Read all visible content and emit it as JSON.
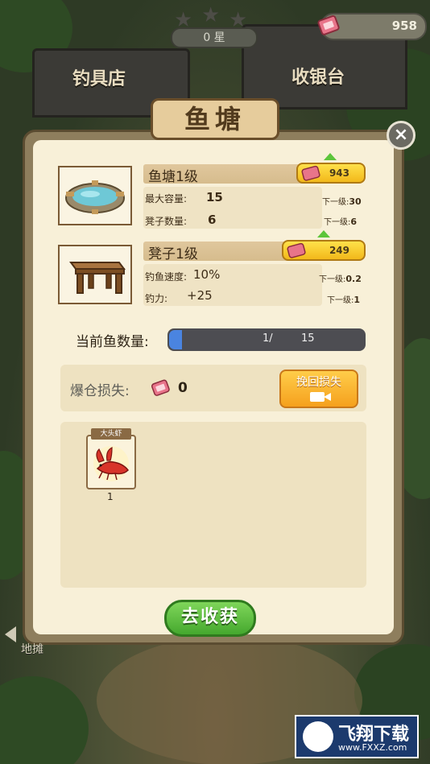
{
  "hud": {
    "star_count": "0 星",
    "currency": "958"
  },
  "scene": {
    "shop_left": "钓具店",
    "shop_right": "收银台",
    "side_label": "地摊"
  },
  "dialog": {
    "title": "鱼塘",
    "close": "×",
    "pond": {
      "level": "鱼塘1级",
      "upgrade_cost": "943",
      "stats": [
        {
          "label": "最大容量:",
          "value": "15",
          "next_label": "下一级:",
          "next_value": "30"
        },
        {
          "label": "凳子数量:",
          "value": "6",
          "next_label": "下一级:",
          "next_value": "6"
        }
      ]
    },
    "stool": {
      "level": "凳子1级",
      "upgrade_cost": "249",
      "stats": [
        {
          "label": "钓鱼速度:",
          "value": "10%",
          "next_label": "下一级:",
          "next_value": "0.2"
        },
        {
          "label": "钓力:",
          "value": "+25",
          "next_label": "下一级:",
          "next_value": "1"
        }
      ]
    },
    "fish_count": {
      "label": "当前鱼数量:",
      "current": "1/",
      "max": "15",
      "fraction": 0.0667
    },
    "loss": {
      "label": "爆仓损失:",
      "value": "0",
      "recover_label": "挽回损失"
    },
    "catch": [
      {
        "name": "大头虾",
        "qty": "1"
      }
    ],
    "harvest_label": "去收获"
  },
  "watermark": {
    "text": "飞翔下载",
    "url": "www.FXXZ.com"
  }
}
